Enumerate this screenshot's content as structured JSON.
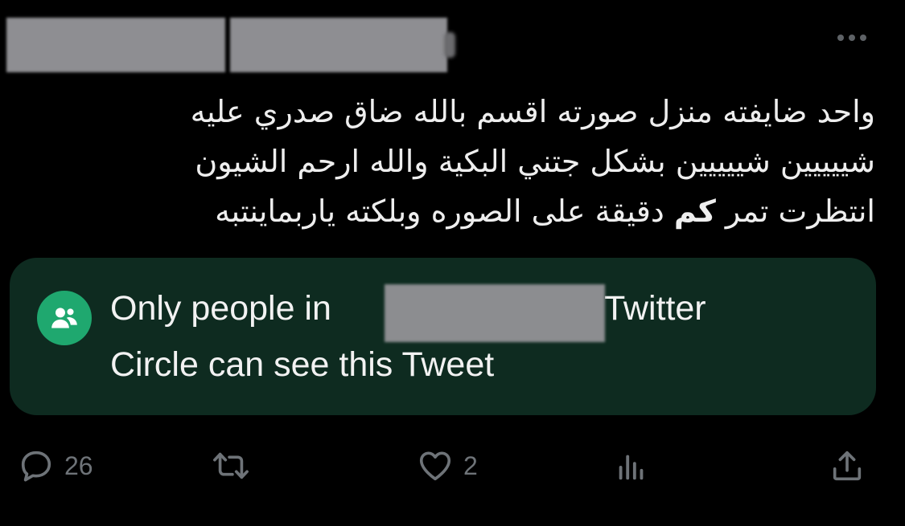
{
  "tweet": {
    "text_lines": [
      "واحد ضايفته منزل صورته اقسم بالله ضاق صدري عليه",
      "شييييين شييييين بشكل جتني البكية والله ارحم الشيون",
      "انتظرت تمر",
      "كم",
      "دقيقة على الصوره وبلكته ياربماينتبه"
    ]
  },
  "circle_notice": {
    "line1_before": "Only people in",
    "line1_after": "Twitter",
    "line2": "Circle can see this Tweet",
    "icon": "people-icon"
  },
  "actions": {
    "reply": {
      "icon": "reply-icon",
      "count": "26"
    },
    "retweet": {
      "icon": "retweet-icon",
      "count": ""
    },
    "like": {
      "icon": "heart-icon",
      "count": "2"
    },
    "views": {
      "icon": "analytics-icon",
      "count": ""
    },
    "share": {
      "icon": "share-icon",
      "count": ""
    }
  },
  "colors": {
    "background": "#000000",
    "circle_banner": "#0e2b20",
    "circle_icon": "#1fa86f",
    "action_gray": "#6e7378"
  }
}
